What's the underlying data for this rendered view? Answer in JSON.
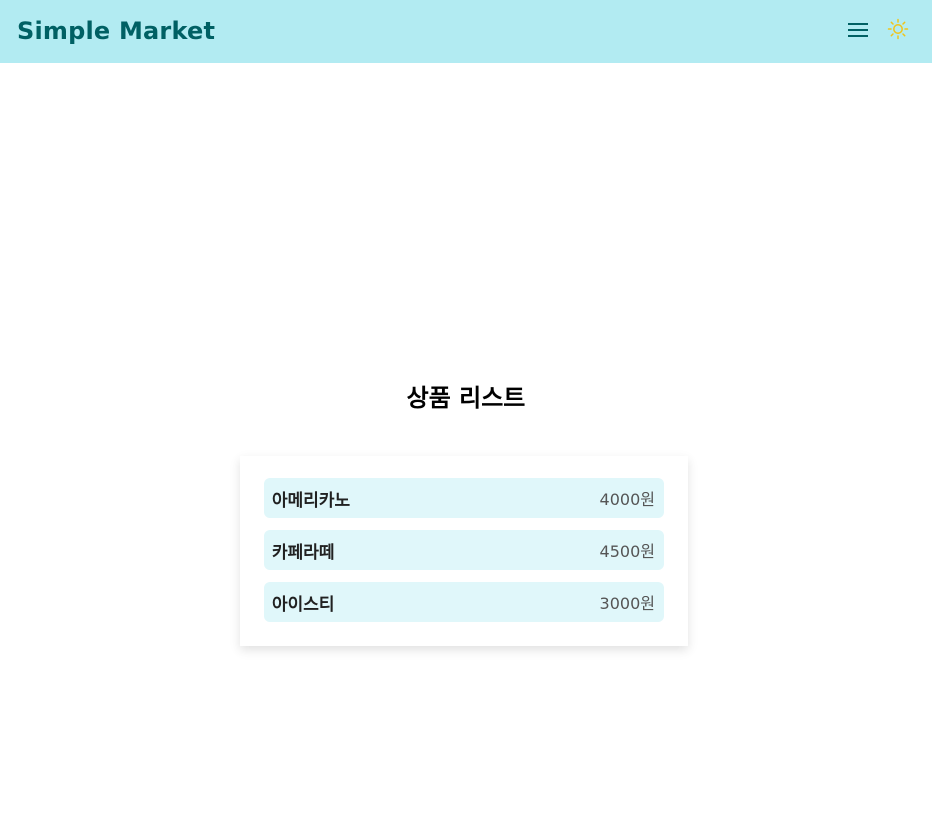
{
  "header": {
    "brand": "Simple Market",
    "menu_icon": "hamburger-menu-icon",
    "theme_icon": "sun-icon"
  },
  "main": {
    "title": "상품 리스트",
    "products": [
      {
        "name": "아메리카노",
        "price": "4000원"
      },
      {
        "name": "카페라떼",
        "price": "4500원"
      },
      {
        "name": "아이스티",
        "price": "3000원"
      }
    ]
  },
  "colors": {
    "header_bg": "#b2ebf2",
    "brand_text": "#006064",
    "item_bg": "#e0f7fa",
    "sun_icon": "#f0c419"
  }
}
